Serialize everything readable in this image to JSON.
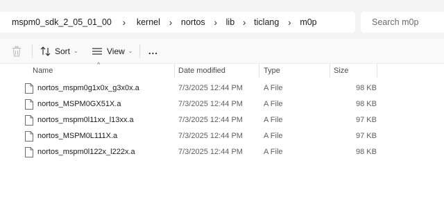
{
  "breadcrumb": [
    "mspm0_sdk_2_05_01_00",
    "kernel",
    "nortos",
    "lib",
    "ticlang",
    "m0p"
  ],
  "search": {
    "placeholder": "Search m0p"
  },
  "toolbar": {
    "sort_label": "Sort",
    "view_label": "View",
    "more_label": "..."
  },
  "columns": {
    "name": "Name",
    "date": "Date modified",
    "type": "Type",
    "size": "Size"
  },
  "files": [
    {
      "name": "nortos_mspm0g1x0x_g3x0x.a",
      "date": "7/3/2025 12:44 PM",
      "type": "A File",
      "size": "98 KB"
    },
    {
      "name": "nortos_MSPM0GX51X.a",
      "date": "7/3/2025 12:44 PM",
      "type": "A File",
      "size": "98 KB"
    },
    {
      "name": "nortos_mspm0l11xx_l13xx.a",
      "date": "7/3/2025 12:44 PM",
      "type": "A File",
      "size": "97 KB"
    },
    {
      "name": "nortos_MSPM0L111X.a",
      "date": "7/3/2025 12:44 PM",
      "type": "A File",
      "size": "97 KB"
    },
    {
      "name": "nortos_mspm0l122x_l222x.a",
      "date": "7/3/2025 12:44 PM",
      "type": "A File",
      "size": "98 KB"
    }
  ]
}
